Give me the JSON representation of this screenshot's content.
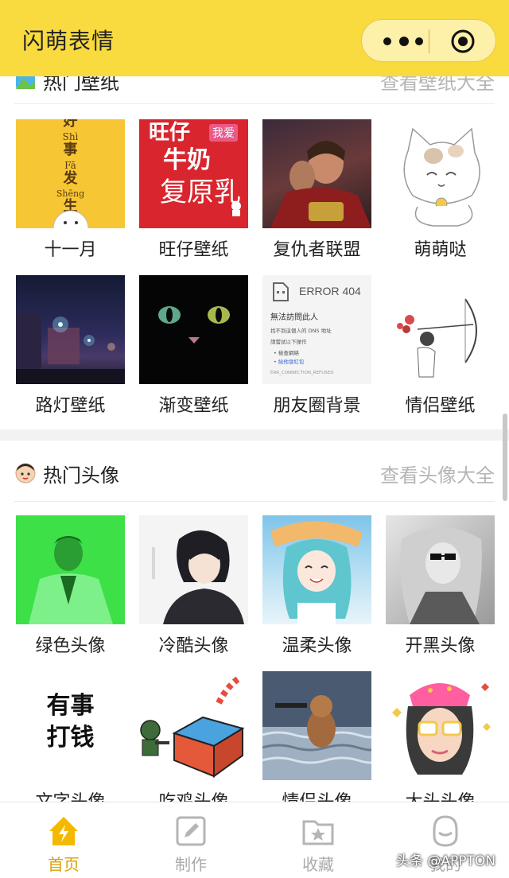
{
  "app": {
    "title": "闪萌表情"
  },
  "wallpapers": {
    "title": "热门壁纸",
    "more": "查看壁纸大全",
    "items": [
      {
        "label": "十一月",
        "text": [
          "好",
          "Shì",
          "事",
          "Fā",
          "发",
          "Shēng",
          "生"
        ]
      },
      {
        "label": "旺仔壁纸",
        "text": [
          "旺仔",
          "我爱",
          "牛奶",
          "复原乳"
        ]
      },
      {
        "label": "复仇者联盟"
      },
      {
        "label": "萌萌哒"
      },
      {
        "label": "路灯壁纸"
      },
      {
        "label": "渐变壁纸"
      },
      {
        "label": "朋友圈背景",
        "text": [
          "ERROR 404",
          "無法訪問此人",
          "找不到這個人的 DNS 地址",
          "請嘗試以下操作",
          "• 檢查網絡",
          "• 給他發紅包",
          "ERR_CONNECTION_REFUSED"
        ]
      },
      {
        "label": "情侣壁纸"
      }
    ]
  },
  "avatars": {
    "title": "热门头像",
    "more": "查看头像大全",
    "items": [
      {
        "label": "绿色头像"
      },
      {
        "label": "冷酷头像"
      },
      {
        "label": "温柔头像"
      },
      {
        "label": "开黑头像"
      },
      {
        "label": "文字头像",
        "text": [
          "有事",
          "打钱"
        ]
      },
      {
        "label": "吃鸡头像"
      },
      {
        "label": "情侣头像"
      },
      {
        "label": "大头头像"
      }
    ]
  },
  "tabs": [
    {
      "label": "首页",
      "icon": "home-icon",
      "active": true
    },
    {
      "label": "制作",
      "icon": "edit-icon",
      "active": false
    },
    {
      "label": "收藏",
      "icon": "favorite-folder-icon",
      "active": false
    },
    {
      "label": "我的",
      "icon": "user-icon",
      "active": false
    }
  ],
  "watermark": "头条 @APPTON",
  "colors": {
    "accent": "#f9da3f",
    "active_tab": "#d7a300",
    "muted": "#b5b5b5"
  }
}
